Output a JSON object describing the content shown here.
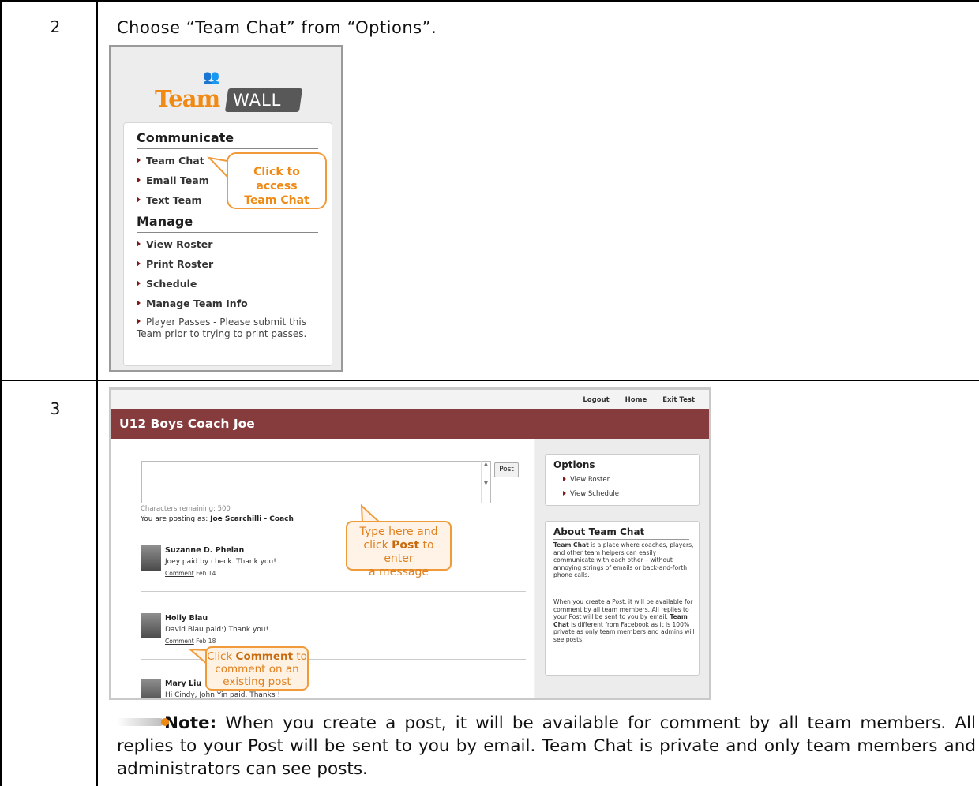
{
  "rows": [
    {
      "step": "2",
      "instruction": "Choose “Team Chat” from “Options”.",
      "menu_screenshot": {
        "logo": {
          "part1": "Team",
          "part2": "WALL"
        },
        "sections": [
          {
            "heading": "Communicate",
            "items": [
              "Team Chat",
              "Email Team",
              "Text Team"
            ]
          },
          {
            "heading": "Manage",
            "items": [
              "View Roster",
              "Print Roster",
              "Schedule",
              "Manage Team Info"
            ]
          }
        ],
        "extra_item": "Player Passes - Please submit this Team prior to trying to print passes.",
        "callout": [
          "Click to",
          "access",
          "Team Chat"
        ]
      }
    },
    {
      "step": "3",
      "chat_screenshot": {
        "top_links": [
          "Logout",
          "Home",
          "Exit Test"
        ],
        "banner_title": "U12 Boys Coach Joe",
        "post_button": "Post",
        "chars_remaining": "Characters remaining: 500",
        "posting_as_label": "You are posting as:",
        "posting_as_name": "Joe Scarchilli - Coach",
        "posts": [
          {
            "name": "Suzanne D. Phelan",
            "message": "Joey paid by check. Thank you!",
            "comment": "Comment",
            "date": "Feb 14"
          },
          {
            "name": "Holly Blau",
            "message": "David Blau paid:) Thank you!",
            "comment": "Comment",
            "date": "Feb 18"
          },
          {
            "name": "Mary Liu",
            "message": "Hi Cindy, John Yin paid. Thanks !"
          }
        ],
        "callout_type": {
          "a": "Type here and",
          "b1": "click ",
          "b_bold": "Post",
          "b2": " to enter",
          "c": "a message"
        },
        "callout_comment": {
          "a1": "Click ",
          "a_bold": "Comment",
          "a2": " to",
          "b": "comment on an",
          "c": "existing post"
        },
        "options_panel": {
          "title": "Options",
          "items": [
            "View Roster",
            "View Schedule"
          ]
        },
        "about_panel": {
          "title": "About Team Chat",
          "p1_bold": "Team Chat",
          "p1": " is a place where coaches, players, and other team helpers can easily communicate with each other – without annoying strings of emails or back-and-forth phone calls.",
          "p2a": "When you create a Post, it will be available for comment by all team members. All replies to your Post will be sent to you by email. ",
          "p2_bold": "Team Chat",
          "p2b": " is different from Facebook as it is 100% private as only team members and admins will see posts."
        }
      },
      "note": {
        "label": "Note:",
        "text": "  When you create a post, it will be available for comment by all team members. All replies to your Post will be sent to you by email. Team Chat is private and only team members and administrators can see posts."
      }
    }
  ]
}
